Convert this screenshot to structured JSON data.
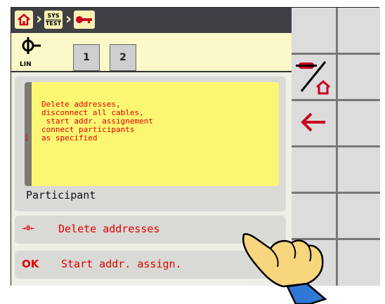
{
  "header": {
    "breadcrumb": [
      "home-icon",
      "sys-test-icon",
      "key-icon"
    ],
    "sys_label_top": "SYS",
    "sys_label_bottom": "TEST"
  },
  "subbar": {
    "lin_label": "LIN",
    "tabs": [
      {
        "label": "1"
      },
      {
        "label": "2"
      }
    ]
  },
  "info": {
    "icon": "i",
    "lines": [
      "Delete addresses,",
      "disconnect all cables,",
      " start addr. assignement",
      "connect participants",
      "as specified"
    ]
  },
  "participant_label": "Participant",
  "actions": {
    "delete": {
      "icon": "→0←",
      "label": "Delete addresses"
    },
    "start": {
      "icon": "OK",
      "label": "Start addr. assign."
    }
  },
  "softkeys": [
    {
      "icon": "device-to-home-icon"
    },
    {
      "icon": "arrow-left-icon"
    }
  ],
  "colors": {
    "accent": "#e10000",
    "header": "#3f3f46",
    "highlight": "#fbf772"
  }
}
